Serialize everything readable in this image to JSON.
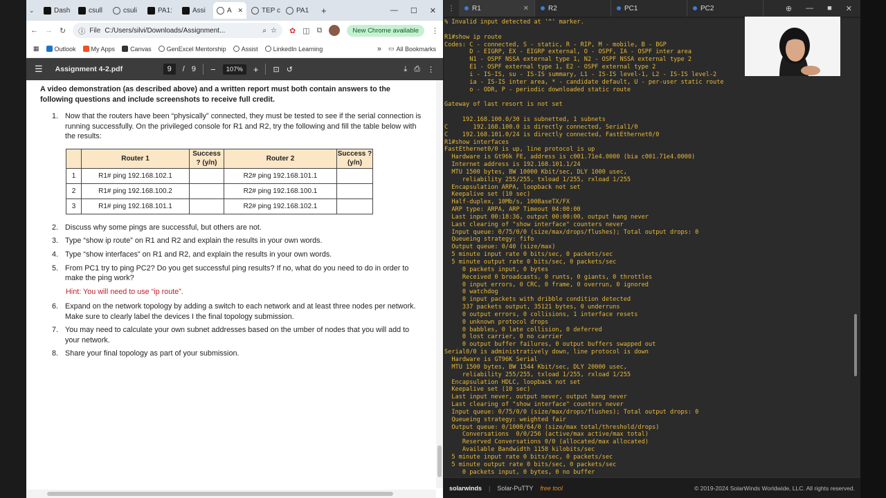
{
  "browser": {
    "tabs": [
      {
        "label": "Dash"
      },
      {
        "label": "csull"
      },
      {
        "label": "csuli"
      },
      {
        "label": "PA1:"
      },
      {
        "label": "Assi"
      },
      {
        "label": "A",
        "active": true
      },
      {
        "label": "TEP c"
      },
      {
        "label": "PA1"
      }
    ],
    "new_tab": "+",
    "url_chip": "File",
    "url": "C:/Users/silvi/Downloads/Assignment...",
    "new_chrome": "New Chrome available",
    "bookmarks": [
      "Outlook",
      "My Apps",
      "Canvas",
      "GenExcel Mentorship",
      "Assist",
      "LinkedIn Learning"
    ],
    "all_bookmarks": "All Bookmarks",
    "overflow": "»"
  },
  "pdf": {
    "title": "Assignment 4-2.pdf",
    "page": "9",
    "page_sep": "/",
    "pages": "9",
    "zoom": "107%",
    "intro": "A video demonstration (as described above) and a written report must both contain answers to the following questions and include screenshots to receive full credit.",
    "q1": "Now that the routers have been “physically” connected, they must be tested to see if the serial connection is running successfully. On the privileged console for R1 and R2, try the following and fill the table below with the results:",
    "table": {
      "headers": [
        "",
        "Router 1",
        "Success ? (y/n)",
        "Router 2",
        "Success ? (y/n)"
      ],
      "rows": [
        [
          "1",
          "R1# ping 192.168.102.1",
          "",
          "R2# ping 192.168.101.1",
          ""
        ],
        [
          "2",
          "R1# ping 192.168.100.2",
          "",
          "R2# ping 192.168.100.1",
          ""
        ],
        [
          "3",
          "R1# ping 192.168.101.1",
          "",
          "R2# ping 192.168.102.1",
          ""
        ]
      ]
    },
    "questions": [
      {
        "n": "2.",
        "text": "Discuss why some pings are successful, but others are not."
      },
      {
        "n": "3.",
        "text": "Type “show ip route” on R1 and R2 and explain the results in your own words."
      },
      {
        "n": "4.",
        "text": "Type “show interfaces” on R1 and R2, and explain the results in your own words."
      },
      {
        "n": "5.",
        "text": "From PC1 try to ping PC2? Do you get successful ping results? If no, what do you need to do in order to make the ping work?"
      }
    ],
    "hint": "Hint: You will need to use “ip route”.",
    "questions2": [
      {
        "n": "6.",
        "text": "Expand on the network topology by adding a switch to each network and at least three nodes per network. Make sure to clearly label the devices I the final topology submission."
      },
      {
        "n": "7.",
        "text": "You may need to calculate your own subnet addresses based on the umber of nodes that you will add to your network."
      },
      {
        "n": "8.",
        "text": "Share your final topology as part of your submission."
      }
    ]
  },
  "putty": {
    "tabs": [
      "R1",
      "R2",
      "PC1",
      "PC2"
    ],
    "terminal": "% Invalid input detected at '^' marker.\n\nR1#show ip route\nCodes: C - connected, S - static, R - RIP, M - mobile, B - BGP\n       D - EIGRP, EX - EIGRP external, O - OSPF, IA - OSPF inter area\n       N1 - OSPF NSSA external type 1, N2 - OSPF NSSA external type 2\n       E1 - OSPF external type 1, E2 - OSPF external type 2\n       i - IS-IS, su - IS-IS summary, L1 - IS-IS level-1, L2 - IS-IS level-2\n       ia - IS-IS inter area, * - candidate default, U - per-user static route\n       o - ODR, P - periodic downloaded static route\n\nGateway of last resort is not set\n\n     192.168.100.0/30 is subnetted, 1 subnets\nC       192.168.100.0 is directly connected, Serial1/0\nC    192.168.101.0/24 is directly connected, FastEthernet0/0\nR1#show interfaces\nFastEthernet0/0 is up, line protocol is up\n  Hardware is Gt96k FE, address is c001.71e4.0000 (bia c001.71e4.0000)\n  Internet address is 192.168.101.1/24\n  MTU 1500 bytes, BW 10000 Kbit/sec, DLY 1000 usec,\n     reliability 255/255, txload 1/255, rxload 1/255\n  Encapsulation ARPA, loopback not set\n  Keepalive set (10 sec)\n  Half-duplex, 10Mb/s, 100BaseTX/FX\n  ARP type: ARPA, ARP Timeout 04:00:00\n  Last input 00:18:36, output 00:00:00, output hang never\n  Last clearing of \"show interface\" counters never\n  Input queue: 0/75/0/0 (size/max/drops/flushes); Total output drops: 0\n  Queueing strategy: fifo\n  Output queue: 0/40 (size/max)\n  5 minute input rate 0 bits/sec, 0 packets/sec\n  5 minute output rate 0 bits/sec, 0 packets/sec\n     0 packets input, 0 bytes\n     Received 0 broadcasts, 0 runts, 0 giants, 0 throttles\n     0 input errors, 0 CRC, 0 frame, 0 overrun, 0 ignored\n     0 watchdog\n     0 input packets with dribble condition detected\n     337 packets output, 35121 bytes, 0 underruns\n     0 output errors, 0 collisions, 1 interface resets\n     0 unknown protocol drops\n     0 babbles, 0 late collision, 0 deferred\n     0 lost carrier, 0 no carrier\n     0 output buffer failures, 0 output buffers swapped out\nSerial0/0 is administratively down, line protocol is down\n  Hardware is GT96K Serial\n  MTU 1500 bytes, BW 1544 Kbit/sec, DLY 20000 usec,\n     reliability 255/255, txload 1/255, rxload 1/255\n  Encapsulation HDLC, loopback not set\n  Keepalive set (10 sec)\n  Last input never, output never, output hang never\n  Last clearing of \"show interface\" counters never\n  Input queue: 0/75/0/0 (size/max/drops/flushes); Total output drops: 0\n  Queueing strategy: weighted fair\n  Output queue: 0/1000/64/0 (size/max total/threshold/drops)\n     Conversations  0/0/256 (active/max active/max total)\n     Reserved Conversations 0/0 (allocated/max allocated)\n     Available Bandwidth 1158 kilobits/sec\n  5 minute input rate 0 bits/sec, 0 packets/sec\n  5 minute output rate 0 bits/sec, 0 packets/sec\n     0 packets input, 0 bytes, 0 no buffer",
    "brand": "solarwinds",
    "product": "Solar-PuTTY",
    "free": "free tool",
    "copyright": "© 2019-2024 SolarWinds Worldwide, LLC. All rights reserved."
  },
  "colors": {
    "terminal_text": "#e8b93a",
    "hint": "#c0202b",
    "table_header": "#fbe6c6"
  }
}
